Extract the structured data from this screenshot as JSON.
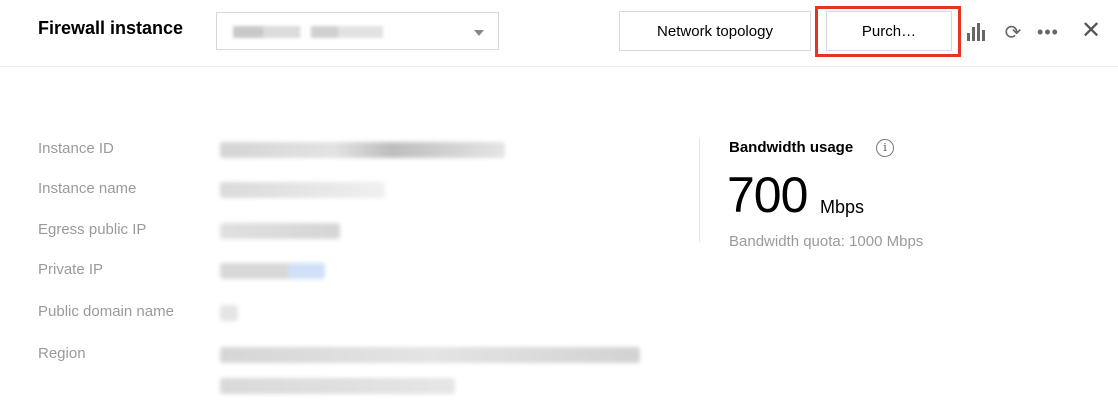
{
  "header": {
    "title": "Firewall instance",
    "select_value_redacted": true,
    "network_topology_label": "Network topology",
    "purchase_label": "Purch…",
    "icons": [
      "bar-chart-icon",
      "refresh-icon",
      "more-icon",
      "close-icon"
    ]
  },
  "details": {
    "rows": [
      {
        "label": "Instance ID",
        "value_redacted": true
      },
      {
        "label": "Instance name",
        "value_redacted": true
      },
      {
        "label": "Egress public IP",
        "value_redacted": true
      },
      {
        "label": "Private IP",
        "value_redacted": true
      },
      {
        "label": "Public domain name",
        "value_redacted": true
      },
      {
        "label": "Region",
        "value_redacted": true
      }
    ]
  },
  "bandwidth": {
    "title": "Bandwidth usage",
    "value": "700",
    "unit": "Mbps",
    "quota": "Bandwidth quota: 1000 Mbps"
  },
  "colors": {
    "highlight": "#e63323",
    "label": "#9a9a9a"
  }
}
